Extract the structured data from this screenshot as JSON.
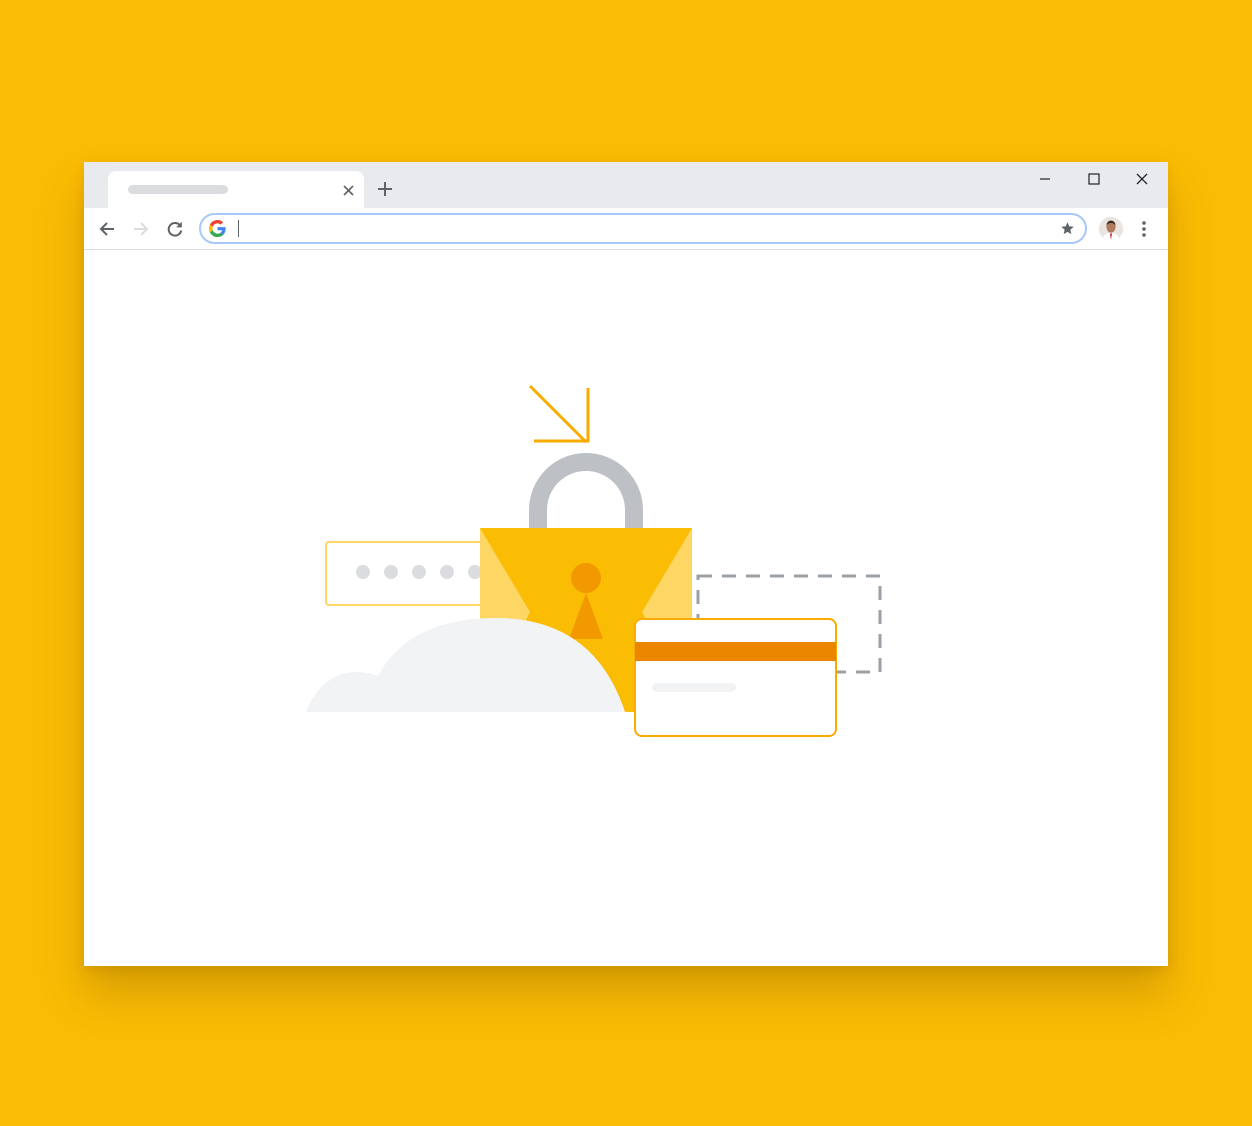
{
  "browser": {
    "tab": {
      "title": ""
    },
    "omnibox": {
      "value": ""
    },
    "controls": [
      "minimize",
      "maximize",
      "close"
    ]
  },
  "icons": {
    "tab_close": "close-icon",
    "new_tab": "plus-icon",
    "back": "arrow-back-icon",
    "forward": "arrow-forward-icon",
    "reload": "reload-icon",
    "search_engine": "google-g-icon",
    "bookmark": "star-icon",
    "profile": "avatar",
    "menu": "more-vert-icon"
  },
  "illustration": {
    "password_dots": 5,
    "subject": "padlock-security"
  },
  "colors": {
    "background": "#FBBC04",
    "tabstrip": "#E8EAED",
    "omnibox_border": "#A8C7FA",
    "lock_body": "#FBBC04",
    "lock_light": "#FDD663",
    "lock_shackle": "#BDC1C6",
    "keyhole": "#F29900",
    "card_stripe": "#EA8600",
    "cloud": "#F1F3F4",
    "dashed_outline": "#9AA0A6"
  }
}
